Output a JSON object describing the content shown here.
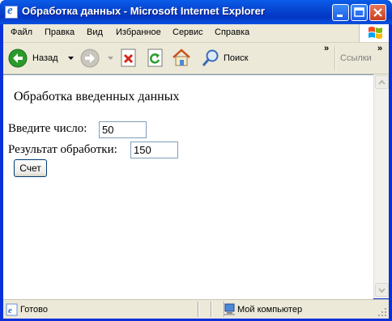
{
  "window": {
    "title": "Обработка данных - Microsoft Internet Explorer"
  },
  "menu": [
    "Файл",
    "Правка",
    "Вид",
    "Избранное",
    "Сервис",
    "Справка"
  ],
  "toolbar": {
    "back_label": "Назад",
    "search_label": "Поиск",
    "links_label": "Ссылки",
    "chevron": "»"
  },
  "page": {
    "heading": "Обработка введенных данных",
    "number_label": "Введите число:",
    "number_value": "50",
    "result_label": "Результат обработки:",
    "result_value": "150",
    "button_label": "Счет"
  },
  "status": {
    "left_text": "Готово",
    "zone_text": "Мой компьютер"
  },
  "colors": {
    "titlebar": "#0646d2",
    "chrome": "#ece9d8",
    "back_green": "#2b9a2b"
  },
  "icons": [
    "ie-logo-icon",
    "minimize-icon",
    "maximize-icon",
    "close-icon",
    "windows-flag-icon",
    "back-arrow-icon",
    "forward-arrow-icon",
    "stop-icon",
    "refresh-icon",
    "home-icon",
    "search-icon",
    "page-icon",
    "computer-icon"
  ]
}
